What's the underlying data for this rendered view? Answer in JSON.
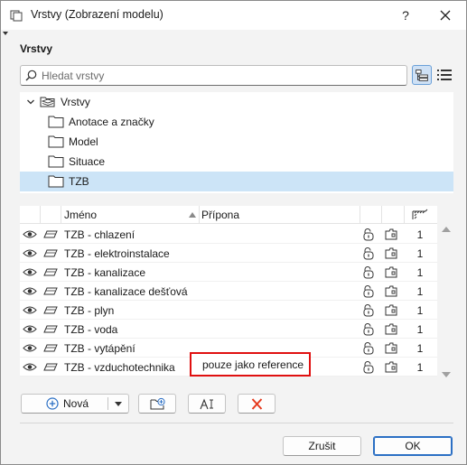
{
  "window": {
    "title": "Vrstvy (Zobrazení modelu)",
    "help_label": "?"
  },
  "section": {
    "title": "Vrstvy"
  },
  "search": {
    "placeholder": "Hledat vrstvy",
    "value": ""
  },
  "tree": {
    "root": "Vrstvy",
    "folders": [
      "Anotace a značky",
      "Model",
      "Situace",
      "TZB"
    ],
    "selected": "TZB"
  },
  "table": {
    "columns": {
      "name": "Jméno",
      "extension": "Přípona"
    },
    "sort_column": "Jméno",
    "rows": [
      {
        "name": "TZB - chlazení",
        "extension": "",
        "pen": "1"
      },
      {
        "name": "TZB - elektroinstalace",
        "extension": "",
        "pen": "1"
      },
      {
        "name": "TZB - kanalizace",
        "extension": "",
        "pen": "1"
      },
      {
        "name": "TZB - kanalizace dešťová",
        "extension": "",
        "pen": "1"
      },
      {
        "name": "TZB - plyn",
        "extension": "",
        "pen": "1"
      },
      {
        "name": "TZB - voda",
        "extension": "",
        "pen": "1"
      },
      {
        "name": "TZB - vytápění",
        "extension": "",
        "pen": "1"
      },
      {
        "name": "TZB - vzduchotechnika",
        "extension": "pouze jako reference",
        "pen": "1"
      }
    ]
  },
  "actions": {
    "new_label": "Nová",
    "cancel_label": "Zrušit",
    "ok_label": "OK"
  },
  "colors": {
    "selection": "#cce4f7",
    "highlight_border": "#e01010",
    "delete_icon": "#e53a1e",
    "primary_border": "#2b6fc4"
  },
  "icons": {
    "title": "layers-app-icon",
    "search": "search-icon",
    "view_tree": "tree-view-icon",
    "view_list": "list-view-icon",
    "visibility": "eye-icon",
    "layer": "layer-icon",
    "lock": "lock-icon",
    "intersection": "intersection-icon",
    "new": "plus-circle-icon",
    "new_folder": "new-folder-icon",
    "rename": "rename-icon",
    "delete": "delete-x-icon"
  }
}
